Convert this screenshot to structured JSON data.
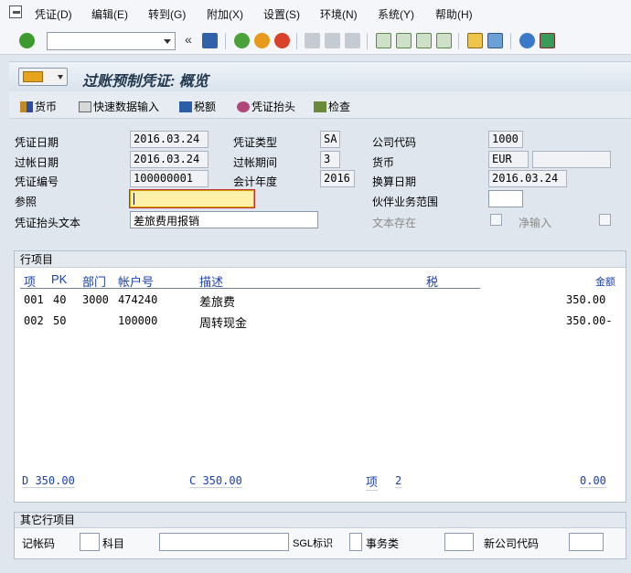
{
  "menu": [
    "凭证(D)",
    "编辑(E)",
    "转到(G)",
    "附加(X)",
    "设置(S)",
    "环境(N)",
    "系统(Y)",
    "帮助(H)"
  ],
  "toolbar": {
    "command_value": "",
    "icons": [
      "enter-icon",
      "back-arrows-icon",
      "save-icon",
      "back-icon",
      "exit-icon",
      "cancel-icon",
      "print-icon",
      "find-icon",
      "find-next-icon",
      "first-page-icon",
      "prev-page-icon",
      "next-page-icon",
      "last-page-icon",
      "create-session-icon",
      "shortcut-icon",
      "help-icon",
      "layout-icon"
    ]
  },
  "title": "过账预制凭证: 概览",
  "app_toolbar": {
    "currency": "货币",
    "fast_entry": "快速数据输入",
    "tax": "税额",
    "doc_header": "凭证抬头",
    "check": "检查"
  },
  "header": {
    "doc_date_label": "凭证日期",
    "doc_date": "2016.03.24",
    "doc_type_label": "凭证类型",
    "doc_type": "SA",
    "company_code_label": "公司代码",
    "company_code": "1000",
    "posting_date_label": "过帐日期",
    "posting_date": "2016.03.24",
    "period_label": "过帐期间",
    "period": "3",
    "currency_label": "货币",
    "currency": "EUR",
    "doc_number_label": "凭证编号",
    "doc_number": "100000001",
    "fiscal_year_label": "会计年度",
    "fiscal_year": "2016",
    "translation_date_label": "换算日期",
    "translation_date": "2016.03.24",
    "reference_label": "参照",
    "reference": "",
    "partner_label": "伙伴业务范围",
    "partner": "",
    "header_text_label": "凭证抬头文本",
    "header_text": "差旅费用报销",
    "text_exists_label": "文本存在",
    "net_entry_label": "净输入"
  },
  "items": {
    "section_title": "行项目",
    "columns": {
      "item": "项",
      "pk": "PK",
      "dept": "部门",
      "account": "帐户号",
      "desc": "描述",
      "tax": "税",
      "amount": "金额"
    },
    "rows": [
      {
        "item": "001",
        "pk": "40",
        "dept": "3000",
        "account": "474240",
        "desc": "差旅费",
        "amount": "350.00"
      },
      {
        "item": "002",
        "pk": "50",
        "dept": "",
        "account": "100000",
        "desc": "周转现金",
        "amount": "350.00-"
      }
    ],
    "totals": {
      "debit": "D 350.00",
      "credit": "C 350.00",
      "count_label": "项",
      "count": "2",
      "balance": "0.00"
    }
  },
  "other": {
    "section_title": "其它行项目",
    "posting_key_label": "记帐码",
    "account_label": "科目",
    "sgl_label": "SGL标识",
    "trans_type_label": "事务类",
    "new_cc_label": "新公司代码"
  }
}
